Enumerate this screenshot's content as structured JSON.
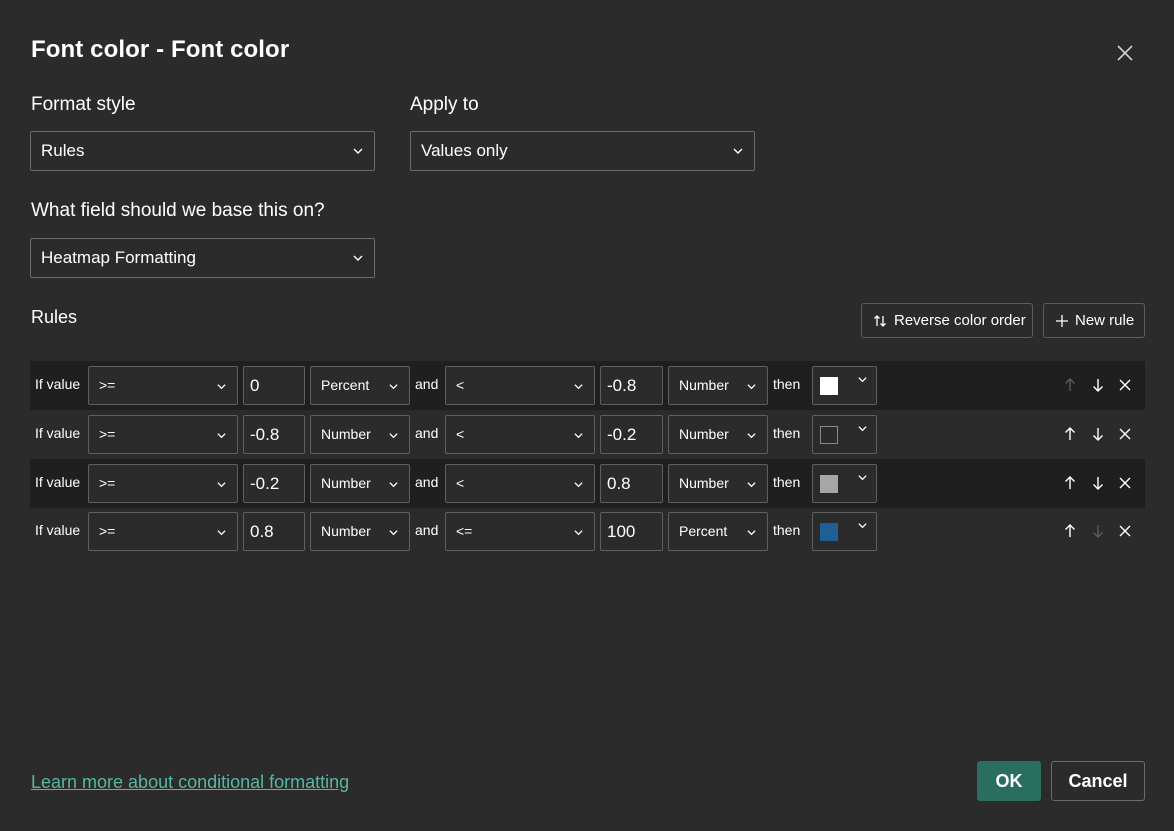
{
  "dialog": {
    "title": "Font color - Font color",
    "close_icon": "close-icon"
  },
  "format_style": {
    "label": "Format style",
    "value": "Rules"
  },
  "apply_to": {
    "label": "Apply to",
    "value": "Values only"
  },
  "base_field": {
    "label": "What field should we base this on?",
    "value": "Heatmap Formatting"
  },
  "rules_section": {
    "label": "Rules",
    "reverse_button": "Reverse color order",
    "new_rule_button": "New rule"
  },
  "rules": [
    {
      "if_label": "If value",
      "op1": ">=",
      "val1": "0",
      "type1": "Percent",
      "and_label": "and",
      "op2": "<",
      "val2": "-0.8",
      "type2": "Number",
      "then_label": "then",
      "color": "#ffffff",
      "up_enabled": false,
      "down_enabled": true
    },
    {
      "if_label": "If value",
      "op1": ">=",
      "val1": "-0.8",
      "type1": "Number",
      "and_label": "and",
      "op2": "<",
      "val2": "-0.2",
      "type2": "Number",
      "then_label": "then",
      "color": "#2b2b2b",
      "up_enabled": true,
      "down_enabled": true
    },
    {
      "if_label": "If value",
      "op1": ">=",
      "val1": "-0.2",
      "type1": "Number",
      "and_label": "and",
      "op2": "<",
      "val2": "0.8",
      "type2": "Number",
      "then_label": "then",
      "color": "#a6a6a6",
      "up_enabled": true,
      "down_enabled": true
    },
    {
      "if_label": "If value",
      "op1": ">=",
      "val1": "0.8",
      "type1": "Number",
      "and_label": "and",
      "op2": "<=",
      "val2": "100",
      "type2": "Percent",
      "then_label": "then",
      "color": "#1f5f96",
      "up_enabled": true,
      "down_enabled": false
    }
  ],
  "footer": {
    "learn_more": "Learn more about conditional formatting",
    "ok": "OK",
    "cancel": "Cancel"
  },
  "colors": {
    "background": "#2b2b2b",
    "row_shade": "#1f1f1f",
    "accent": "#2a6e5f",
    "link": "#57b7a3"
  }
}
